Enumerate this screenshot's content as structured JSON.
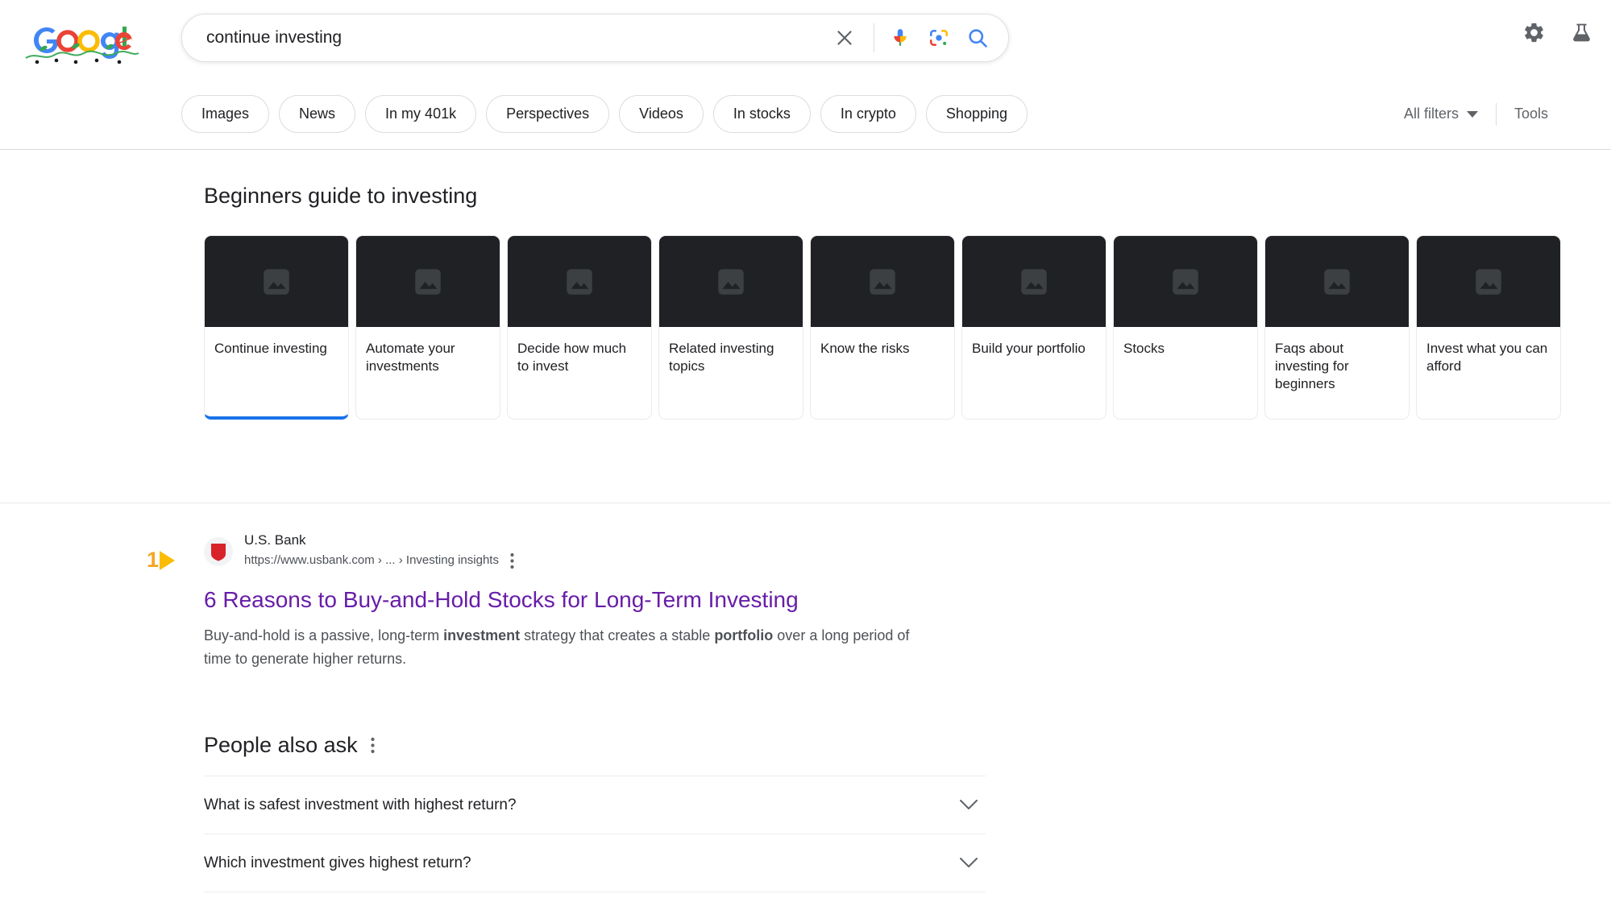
{
  "header": {
    "logo_alt": "google-doodle-logo",
    "search": {
      "value": "continue investing",
      "placeholder": "Search",
      "clear_label": "Clear",
      "voice_label": "Search by voice",
      "lens_label": "Search by image",
      "submit_label": "Google Search"
    },
    "actions": [
      {
        "name": "settings-icon",
        "label": "Quick Settings"
      },
      {
        "name": "labs-icon",
        "label": "Google Labs"
      }
    ]
  },
  "filters": {
    "chips": [
      {
        "label": "Images"
      },
      {
        "label": "News"
      },
      {
        "label": "In my 401k"
      },
      {
        "label": "Perspectives"
      },
      {
        "label": "Videos"
      },
      {
        "label": "In stocks"
      },
      {
        "label": "In crypto"
      },
      {
        "label": "Shopping"
      }
    ],
    "all_filters_label": "All filters",
    "tools_label": "Tools"
  },
  "carousel": {
    "title": "Beginners guide to investing",
    "cards": [
      {
        "label": "Continue investing",
        "active": true
      },
      {
        "label": "Automate your investments",
        "active": false
      },
      {
        "label": "Decide how much to invest",
        "active": false
      },
      {
        "label": "Related investing topics",
        "active": false
      },
      {
        "label": "Know the risks",
        "active": false
      },
      {
        "label": "Build your portfolio",
        "active": false
      },
      {
        "label": "Stocks",
        "active": false
      },
      {
        "label": "Faqs about investing for beginners",
        "active": false
      },
      {
        "label": "Invest what you can afford",
        "active": false
      }
    ]
  },
  "result": {
    "annotation_number": "1",
    "site_name": "U.S. Bank",
    "url": "https://www.usbank.com › ... › Investing insights",
    "title": "6 Reasons to Buy-and-Hold Stocks for Long-Term Investing",
    "snippet_part1": "Buy-and-hold is a passive, long-term ",
    "snippet_bold1": "investment",
    "snippet_part2": " strategy that creates a stable ",
    "snippet_bold2": "portfolio",
    "snippet_part3": " over a long period of time to generate higher returns."
  },
  "people_also_ask": {
    "title": "People also ask",
    "questions": [
      {
        "text": "What is safest investment with highest return?"
      },
      {
        "text": "Which investment gives highest return?"
      }
    ]
  },
  "colors": {
    "google_blue": "#4285f4",
    "google_red": "#ea4335",
    "google_yellow": "#fbbc04",
    "google_green": "#34a853",
    "link_visited": "#681da8",
    "active_underline": "#1a73e8",
    "annotation": "#fbbc04",
    "usbank_red": "#d8232a"
  }
}
